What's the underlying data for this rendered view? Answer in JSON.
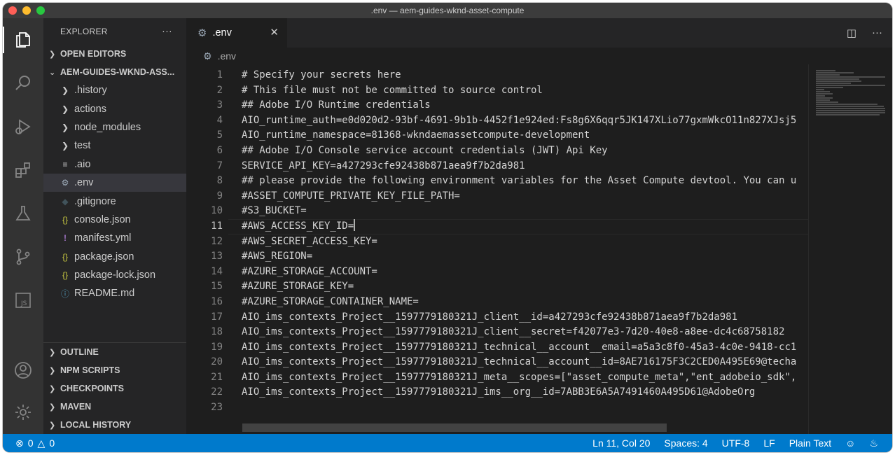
{
  "window": {
    "title": ".env — aem-guides-wknd-asset-compute"
  },
  "sidebar": {
    "header": "EXPLORER",
    "more": "···",
    "open_editors": "OPEN EDITORS",
    "project": "AEM-GUIDES-WKND-ASS...",
    "files": [
      {
        "name": ".history",
        "kind": "folder"
      },
      {
        "name": "actions",
        "kind": "folder"
      },
      {
        "name": "node_modules",
        "kind": "folder"
      },
      {
        "name": "test",
        "kind": "folder"
      },
      {
        "name": ".aio",
        "kind": "file-lines"
      },
      {
        "name": ".env",
        "kind": "gear"
      },
      {
        "name": ".gitignore",
        "kind": "git"
      },
      {
        "name": "console.json",
        "kind": "json"
      },
      {
        "name": "manifest.yml",
        "kind": "yaml"
      },
      {
        "name": "package.json",
        "kind": "json"
      },
      {
        "name": "package-lock.json",
        "kind": "json"
      },
      {
        "name": "README.md",
        "kind": "info"
      }
    ],
    "bottom_sections": [
      "OUTLINE",
      "NPM SCRIPTS",
      "CHECKPOINTS",
      "MAVEN",
      "LOCAL HISTORY"
    ]
  },
  "tab": {
    "label": ".env"
  },
  "breadcrumb": {
    "file": ".env"
  },
  "editor": {
    "current_line": 11,
    "lines": [
      "# Specify your secrets here",
      "# This file must not be committed to source control",
      "## Adobe I/O Runtime credentials",
      "AIO_runtime_auth=e0d020d2-93bf-4691-9b1b-4452f1e924ed:Fs8g6X6qqr5JK147XLio77gxmWkcO11n827XJsj5",
      "AIO_runtime_namespace=81368-wkndaemassetcompute-development",
      "## Adobe I/O Console service account credentials (JWT) Api Key",
      "SERVICE_API_KEY=a427293cfe92438b871aea9f7b2da981",
      "## please provide the following environment variables for the Asset Compute devtool. You can u",
      "#ASSET_COMPUTE_PRIVATE_KEY_FILE_PATH=",
      "#S3_BUCKET=",
      "#AWS_ACCESS_KEY_ID=",
      "#AWS_SECRET_ACCESS_KEY=",
      "#AWS_REGION=",
      "#AZURE_STORAGE_ACCOUNT=",
      "#AZURE_STORAGE_KEY=",
      "#AZURE_STORAGE_CONTAINER_NAME=",
      "AIO_ims_contexts_Project__1597779180321J_client__id=a427293cfe92438b871aea9f7b2da981",
      "AIO_ims_contexts_Project__1597779180321J_client__secret=f42077e3-7d20-40e8-a8ee-dc4c68758182",
      "AIO_ims_contexts_Project__1597779180321J_technical__account__email=a5a3c8f0-45a3-4c0e-9418-cc1",
      "AIO_ims_contexts_Project__1597779180321J_technical__account__id=8AE716175F3C2CED0A495E69@techa",
      "AIO_ims_contexts_Project__1597779180321J_meta__scopes=[\"asset_compute_meta\",\"ent_adobeio_sdk\",",
      "AIO_ims_contexts_Project__1597779180321J_ims__org__id=7ABB3E6A5A7491460A495D61@AdobeOrg",
      ""
    ]
  },
  "status": {
    "errors": "0",
    "warnings": "0",
    "position": "Ln 11, Col 20",
    "spaces": "Spaces: 4",
    "encoding": "UTF-8",
    "eol": "LF",
    "language": "Plain Text"
  },
  "colors": {
    "status_bar": "#007acc",
    "activity_bar": "#333333",
    "sidebar": "#252526",
    "editor": "#1e1e1e"
  }
}
